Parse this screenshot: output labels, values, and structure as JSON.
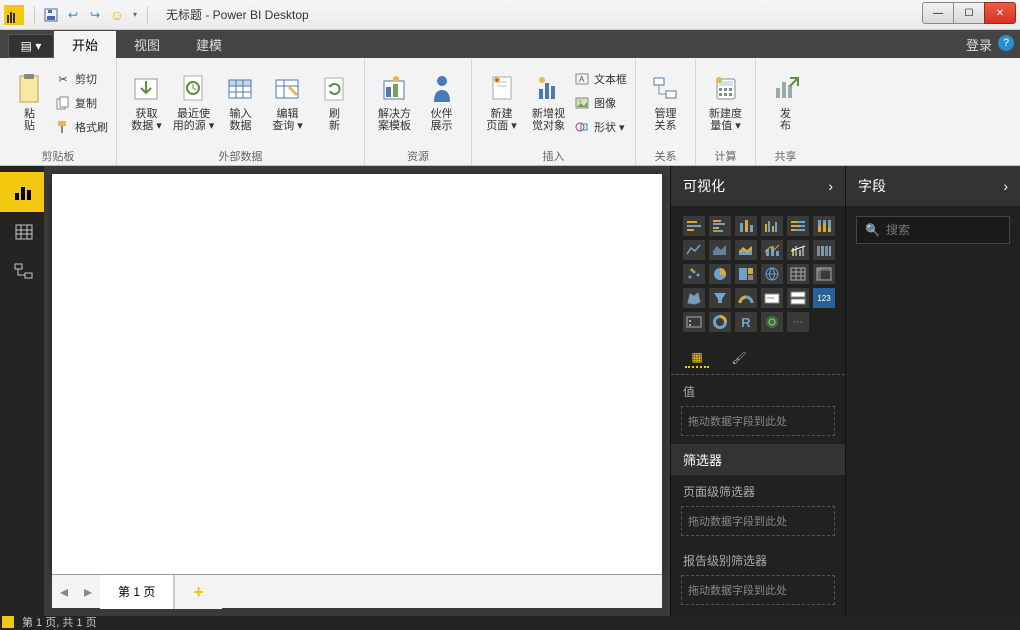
{
  "title": "无标题 - Power BI Desktop",
  "qat": {
    "undo": "↩",
    "redo": "↪",
    "smile": "☺",
    "menu": "▾"
  },
  "win": {
    "min": "—",
    "max": "☐",
    "close": "✕"
  },
  "tabs": {
    "file": "▤ ▾",
    "start": "开始",
    "view": "视图",
    "model": "建模",
    "login": "登录",
    "help": "?"
  },
  "ribbon": {
    "clipboard": {
      "label": "剪贴板",
      "paste": "粘\n贴",
      "cut": "剪切",
      "copy": "复制",
      "format": "格式刷"
    },
    "extdata": {
      "label": "外部数据",
      "get": "获取\n数据 ▾",
      "recent": "最近使\n用的源 ▾",
      "enter": "输入\n数据",
      "edit": "编辑\n查询 ▾",
      "refresh": "刷\n新"
    },
    "resource": {
      "label": "资源",
      "template": "解决方\n案模板",
      "partner": "伙伴\n展示"
    },
    "insert": {
      "label": "插入",
      "newpage": "新建\n页面 ▾",
      "visual": "新增视\n觉对象",
      "textbox": "文本框",
      "image": "图像",
      "shape": "形状 ▾"
    },
    "relation": {
      "label": "关系",
      "manage": "管理\n关系"
    },
    "calc": {
      "label": "计算",
      "measure": "新建度\n量值 ▾"
    },
    "share": {
      "label": "共享",
      "publish": "发\n布"
    }
  },
  "viz": {
    "header": "可视化",
    "subtabs": {
      "fields": "▦",
      "format": "🖌"
    },
    "value_label": "值",
    "drop_hint": "拖动数据字段到此处",
    "filters_header": "筛选器",
    "page_filter_label": "页面级筛选器",
    "report_filter_label": "报告级别筛选器"
  },
  "fields": {
    "header": "字段",
    "search_placeholder": "搜索"
  },
  "pages": {
    "tab1": "第 1 页",
    "add": "+"
  },
  "status": "第 1 页, 共 1 页"
}
